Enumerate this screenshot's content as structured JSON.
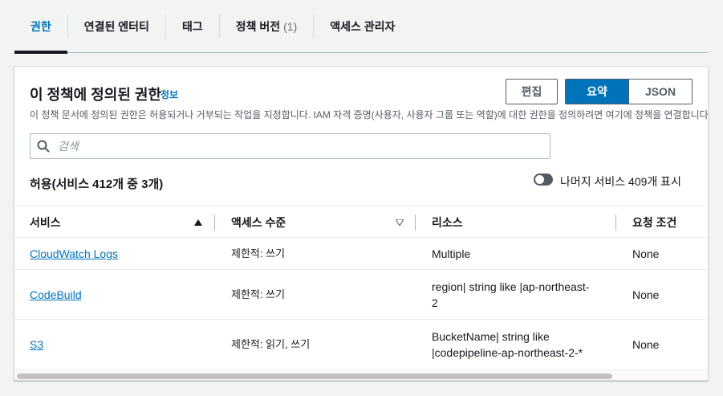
{
  "tabs": [
    {
      "label": "권한",
      "count": ""
    },
    {
      "label": "연결된 엔터티",
      "count": ""
    },
    {
      "label": "태그",
      "count": ""
    },
    {
      "label": "정책 버전",
      "count": "(1)"
    },
    {
      "label": "액세스 관리자",
      "count": ""
    }
  ],
  "panel": {
    "title": "이 정책에 정의된 권한",
    "info_link": "정보",
    "description": "이 정책 문서에 정의된 권한은 허용되거나 거부되는 작업을 지정합니다. IAM 자격 증명(사용자, 사용자 그룹 또는 역할)에 대한 권한을 정의하려면 여기에 정책을 연결합니다.",
    "edit_label": "편집",
    "view_toggle": [
      "요약",
      "JSON"
    ]
  },
  "search": {
    "placeholder": "검색"
  },
  "allow": {
    "title": "허용(서비스 412개 중 3개)",
    "toggle_label": "나머지 서비스 409개 표시"
  },
  "table": {
    "columns": [
      "서비스",
      "액세스 수준",
      "리소스",
      "요청 조건"
    ],
    "rows": [
      {
        "service": "CloudWatch Logs",
        "access": "제한적: 쓰기",
        "resource": "Multiple",
        "condition": "None"
      },
      {
        "service": "CodeBuild",
        "access": "제한적: 쓰기",
        "resource_lines": [
          "region| string like |ap-northeast-",
          "2"
        ],
        "condition": "None"
      },
      {
        "service": "S3",
        "access": "제한적: 읽기, 쓰기",
        "resource_lines": [
          "BucketName| string like",
          "|codepipeline-ap-northeast-2-*"
        ],
        "condition": "None"
      }
    ]
  },
  "colors": {
    "accent": "#0073bb",
    "text": "#16191f",
    "muted": "#545b64",
    "background": "#f2f3f3"
  },
  "icons": {
    "search": "search-icon",
    "sort_asc": "sort-ascending-icon",
    "sort_desc": "sort-descending-icon"
  }
}
